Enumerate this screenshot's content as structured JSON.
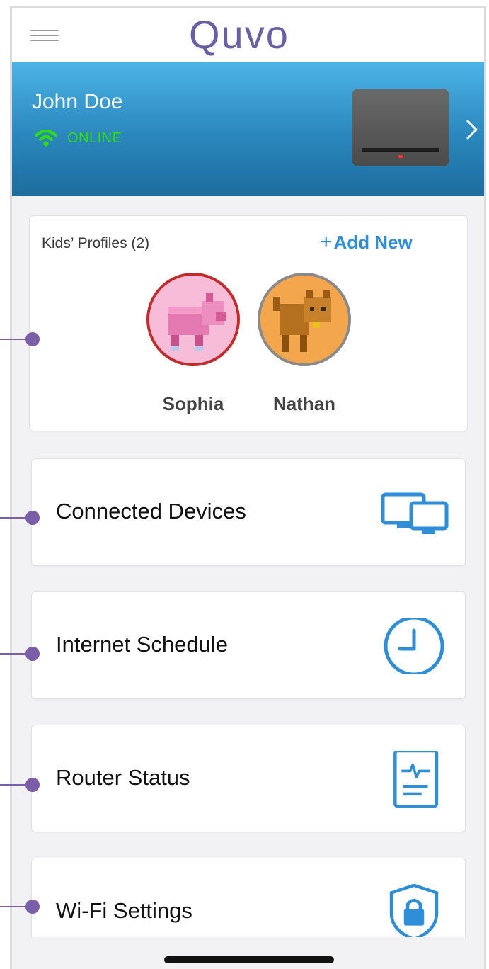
{
  "app": {
    "logo_text": "Quvo",
    "brand_color": "#6a5fa6"
  },
  "header": {
    "menu_icon": "hamburger-icon"
  },
  "hero": {
    "user_name": "John Doe",
    "status_text": "ONLINE",
    "status_icon": "wifi-icon",
    "status_color": "#2ee000",
    "device_image": "router-image",
    "nav_icon": "chevron-right-icon"
  },
  "kids_profiles": {
    "title": "Kids’ Profiles (2)",
    "add_plus": "+",
    "add_label": "Add New",
    "profiles": [
      {
        "name": "Sophia",
        "avatar": "pig-avatar",
        "ring_color": "#c42a2a"
      },
      {
        "name": "Nathan",
        "avatar": "cat-avatar",
        "ring_color": "#8a8a8a"
      }
    ]
  },
  "menu": [
    {
      "label": "Connected Devices",
      "icon": "devices-icon"
    },
    {
      "label": "Internet Schedule",
      "icon": "clock-icon"
    },
    {
      "label": "Router Status",
      "icon": "router-status-icon"
    },
    {
      "label": "Wi-Fi Settings",
      "icon": "lock-shield-icon"
    }
  ],
  "accent_color": "#2e8ed8"
}
